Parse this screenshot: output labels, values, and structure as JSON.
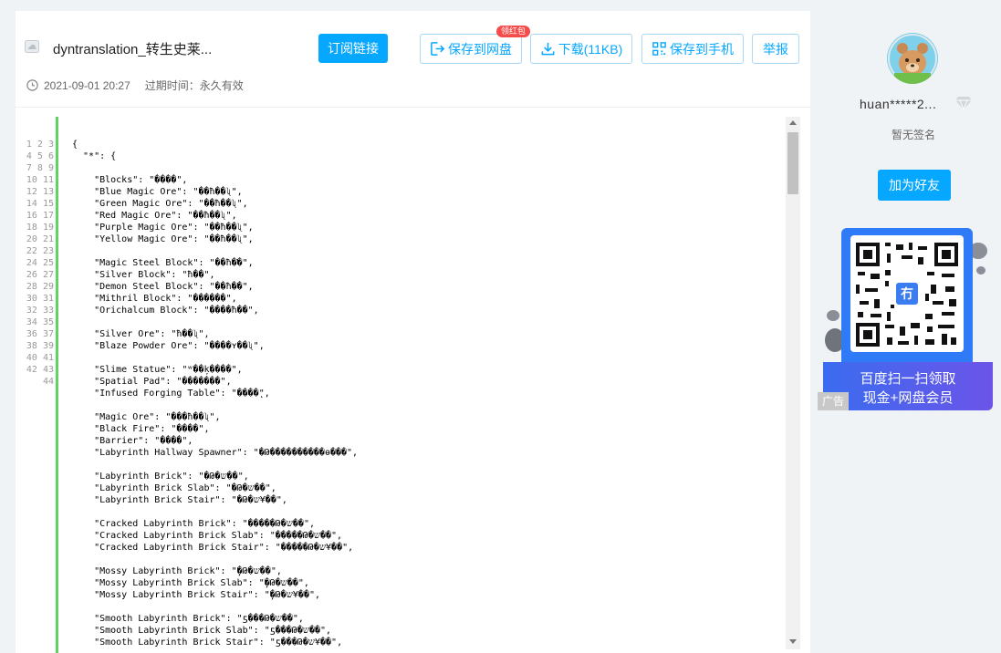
{
  "file": {
    "name": "dyntranslation_转生史莱...",
    "date": "2021-09-01 20:27",
    "expire_label": "过期时间：永久有效"
  },
  "toolbar": {
    "subscribe_label": "订阅链接",
    "save_label": "保存到网盘",
    "save_badge": "领红包",
    "download_label": "下载(11KB)",
    "phone_label": "保存到手机",
    "report_label": "举报"
  },
  "code": {
    "line_numbers": "1\n2\n3\n4\n5\n6\n7\n8\n9\n10\n11\n12\n13\n14\n15\n16\n17\n18\n19\n20\n21\n22\n23\n24\n25\n26\n27\n28\n29\n30\n31\n32\n33\n34\n35\n36\n37\n38\n39\n40\n41\n42\n43\n44",
    "text": "{\n  \"*\": {\n\n    \"Blocks\": \"����\",\n    \"Blue Magic Ore\": \"��ħ��ʯ\",\n    \"Green Magic Ore\": \"��ħ��ʯ\",\n    \"Red Magic Ore\": \"��ħ��ʯ\",\n    \"Purple Magic Ore\": \"��ħ��ʯ\",\n    \"Yellow Magic Ore\": \"��ħ��ʯ\",\n\n    \"Magic Steel Block\": \"��ħ�ֿ�\",\n    \"Silver Block\": \"ħ��\",\n    \"Demon Steel Block\": \"��ħ��\",\n    \"Mithril Block\": \"������\",\n    \"Orichalcum Block\": \"����ħ��\",\n\n    \"Silver Ore\": \"ħ��ʯ\",\n    \"Blaze Powder Ore\": \"����ʏ��ʯ\",\n\n    \"Slime Statue\": \"ʷ��ķ����\",\n    \"Spatial Pad\": \"�������\",\n    \"Infused Forging Table\": \"����̨\",\n\n    \"Magic Ore\": \"���ħ��ʯ\",\n    \"Black Fire\": \"����\",\n    \"Barrier\": \"����\",\n    \"Labyrinth Hallway Spawner\": \"�Թ����������ɵ���\",\n\n    \"Labyrinth Brick\": \"�Թ�ש��\",\n    \"Labyrinth Brick Slab\": \"�Թ�ש��\",\n    \"Labyrinth Brick Stair\": \"�Թ�ש¥��\",\n\n    \"Cracked Labyrinth Brick\": \"�����Թ�ש��\",\n    \"Cracked Labyrinth Brick Slab\": \"�����Թ�ש��\",\n    \"Cracked Labyrinth Brick Stair\": \"�����Թ�ש¥��\",\n\n    \"Mossy Labyrinth Brick\": \"̦�Թ�ש��\",\n    \"Mossy Labyrinth Brick Slab\": \"̦�Թ�ש��\",\n    \"Mossy Labyrinth Brick Stair\": \"̦�Թ�ש¥��\",\n\n    \"Smooth Labyrinth Brick\": \"ƽ���Թ�ש��\",\n    \"Smooth Labyrinth Brick Slab\": \"ƽ���Թ�ש��\",\n    \"Smooth Labyrinth Brick Stair\": \"ƽ���Թ�ש¥��\",\n"
  },
  "user": {
    "name": "huan*****2...",
    "signature": "暂无签名",
    "add_friend_label": "加为好友"
  },
  "ad": {
    "line1": "百度扫一扫领取",
    "line2": "现金+网盘会员",
    "label": "广告",
    "qr_logo": "冇"
  },
  "colors": {
    "accent": "#06a7ff",
    "gutter_bar": "#61d265",
    "badge": "#f64b4b"
  }
}
